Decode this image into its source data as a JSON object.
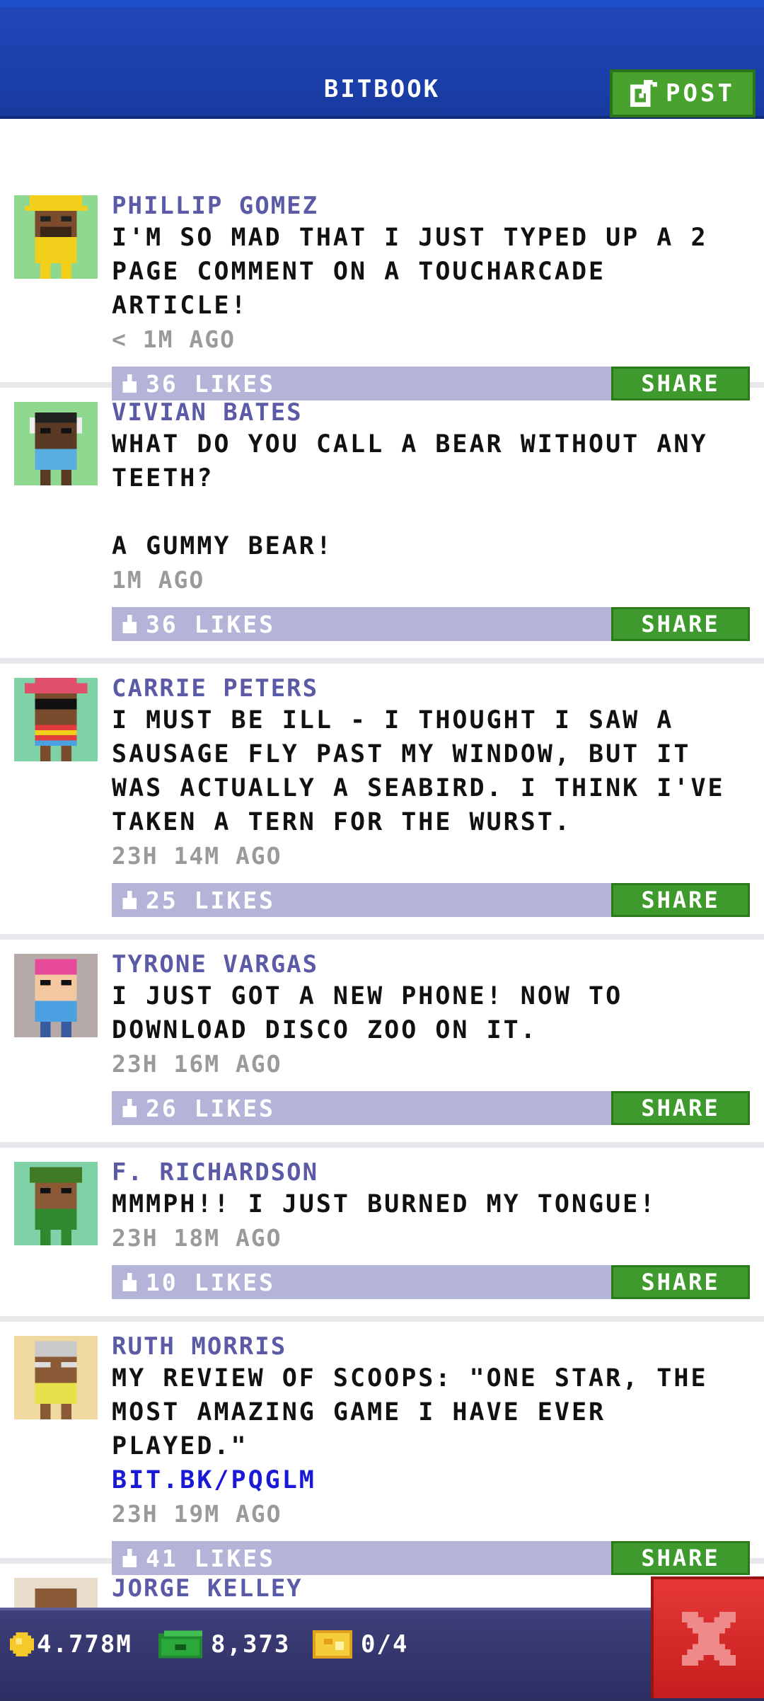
{
  "colors": {
    "header_bg": "#1a3ea9",
    "author": "#5a5aa6",
    "likes_bar": "#b3b4d8",
    "share_green": "#3f9a2d",
    "link": "#1a1ad6",
    "close_red": "#d42a2a",
    "bottom_bar": "#35366c"
  },
  "header": {
    "title": "BITBOOK",
    "post_label": "POST",
    "post_icon": "edit-icon"
  },
  "posts": [
    {
      "author": "PHILLIP GOMEZ",
      "message": "I'M SO MAD THAT I JUST TYPED UP A 2 PAGE COMMENT ON A TOUCHARCADE ARTICLE!",
      "link": "",
      "time": "< 1M AGO",
      "likes": "36 LIKES",
      "share": "SHARE",
      "avatar_bg": "#8fd88f"
    },
    {
      "author": "VIVIAN BATES",
      "message": "WHAT DO YOU CALL A BEAR WITHOUT ANY TEETH?\n\nA GUMMY BEAR!",
      "link": "",
      "time": "1M AGO",
      "likes": "36 LIKES",
      "share": "SHARE",
      "avatar_bg": "#8fd88f"
    },
    {
      "author": "CARRIE PETERS",
      "message": "I MUST BE ILL - I THOUGHT I SAW A SAUSAGE FLY PAST MY WINDOW, BUT IT WAS ACTUALLY A SEABIRD. I THINK I'VE TAKEN A TERN FOR THE WURST.",
      "link": "",
      "time": "23H 14M AGO",
      "likes": "25 LIKES",
      "share": "SHARE",
      "avatar_bg": "#7fd1a6"
    },
    {
      "author": "TYRONE VARGAS",
      "message": "I JUST GOT A NEW PHONE! NOW TO DOWNLOAD DISCO ZOO ON IT.",
      "link": "",
      "time": "23H 16M AGO",
      "likes": "26 LIKES",
      "share": "SHARE",
      "avatar_bg": "#b5aaa8"
    },
    {
      "author": "F. RICHARDSON",
      "message": "MMMPH!! I JUST BURNED MY TONGUE!",
      "link": "",
      "time": "23H 18M AGO",
      "likes": "10 LIKES",
      "share": "SHARE",
      "avatar_bg": "#7fd1a6"
    },
    {
      "author": "RUTH MORRIS",
      "message": "MY REVIEW OF SCOOPS: \"ONE STAR, THE MOST AMAZING GAME I HAVE EVER PLAYED.\"",
      "link": "BIT.BK/PQGLM",
      "time": "23H 19M AGO",
      "likes": "41 LIKES",
      "share": "SHARE",
      "avatar_bg": "#efd9a0"
    },
    {
      "author": "JORGE KELLEY",
      "message": "",
      "link": "",
      "time": "",
      "likes": "",
      "share": "",
      "avatar_bg": "#e8dccb"
    }
  ],
  "bottom_bar": {
    "coins": "4.778M",
    "cash": "8,373",
    "tickets": "0/4",
    "coin_icon": "coin-icon",
    "cash_icon": "cash-icon",
    "ticket_icon": "ticket-icon",
    "close_icon": "close-icon"
  }
}
